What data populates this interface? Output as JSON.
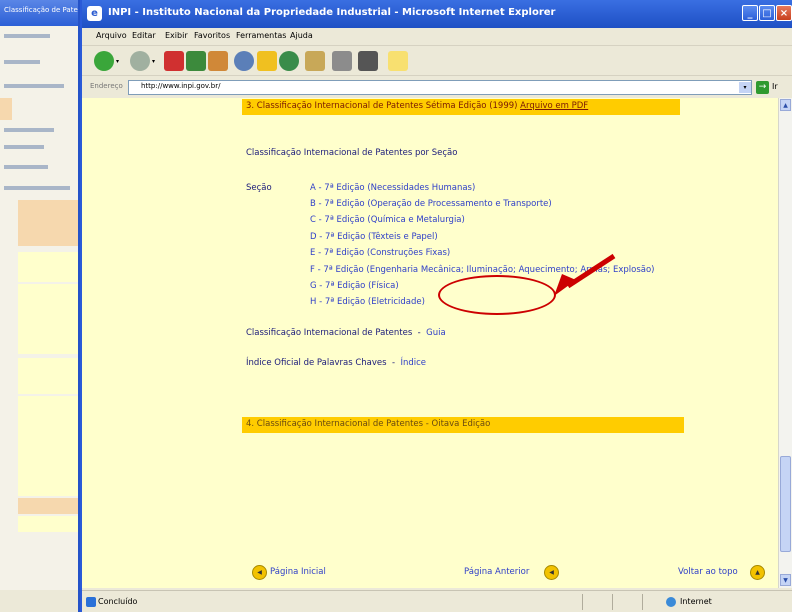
{
  "background_window": {
    "title": "Classificação de Patentes"
  },
  "window": {
    "title": "INPI - Instituto Nacional da Propriedade Industrial - Microsoft Internet Explorer",
    "controls": [
      "minimize",
      "maximize",
      "close"
    ]
  },
  "menu": {
    "items": [
      "Arquivo",
      "Editar",
      "Exibir",
      "Favoritos",
      "Ferramentas",
      "Ajuda"
    ]
  },
  "toolbar": {
    "icons": [
      "back-icon",
      "forward-icon",
      "stop-icon",
      "refresh-icon",
      "home-icon",
      "search-icon",
      "favorites-icon",
      "history-icon",
      "mail-icon",
      "print-icon",
      "edit-icon",
      "messenger-icon"
    ]
  },
  "address": {
    "label": "Endereço",
    "value": "http://www.inpi.gov.br/",
    "go_label": "Ir"
  },
  "page": {
    "section3_title": "3. Classificação Internacional de Patentes Sétima Edição (1999)",
    "section3_link": "Arquivo em PDF",
    "by_section_heading": "Classificação Internacional de Patentes por Seção",
    "section_label": "Seção",
    "sections": [
      "A - 7ª Edição (Necessidades Humanas)",
      "B - 7ª Edição (Operação de Processamento e Transporte)",
      "C - 7ª Edição (Química e Metalurgia)",
      "D - 7ª Edição (Têxteis e Papel)",
      "E - 7ª Edição (Construções Fixas)",
      "F - 7ª Edição (Engenharia Mecânica; Iluminação; Aquecimento; Armas; Explosão)",
      "G - 7ª Edição (Física)",
      "H - 7ª Edição (Eletricidade)"
    ],
    "guide_heading": "Classificação Internacional de Patentes",
    "guide_link": "Guia",
    "index_heading": "Índice Oficial de Palavras Chaves",
    "index_link": "Índice",
    "section4_title": "4. Classificação Internacional de Patentes - Oitava Edição",
    "nav": {
      "first": "Página Inicial",
      "previous": "Página Anterior",
      "top": "Voltar ao topo"
    }
  },
  "status": {
    "text": "Concluído",
    "zone": "Internet"
  },
  "colors": {
    "content_bg": "#ffffcc",
    "section_bar": "#ffcc00",
    "link": "#3040c8",
    "annotation": "#cc0000",
    "titlebar": "#2e62d6"
  }
}
